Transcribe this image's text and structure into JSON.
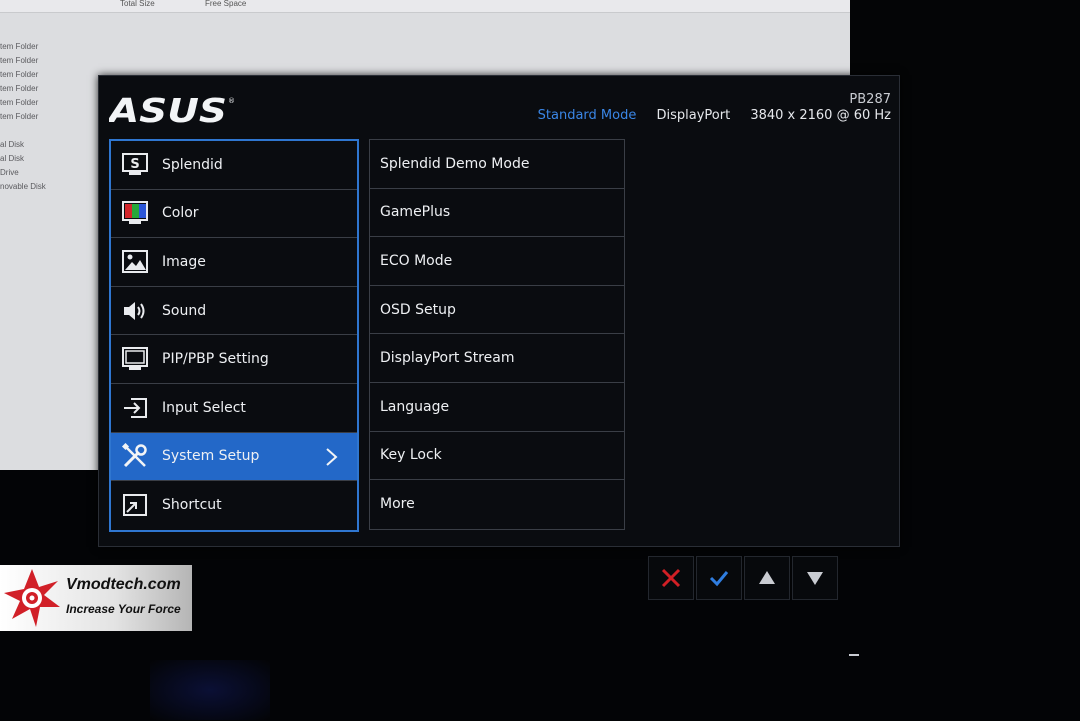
{
  "background": {
    "columns": [
      "Total Size",
      "Free Space"
    ],
    "items": [
      "tem Folder",
      "tem Folder",
      "tem Folder",
      "tem Folder",
      "tem Folder",
      "tem Folder",
      "",
      "al Disk",
      "al Disk",
      "Drive",
      "novable Disk"
    ]
  },
  "osd": {
    "brand": "ASUS",
    "header": {
      "model": "PB287",
      "mode": "Standard Mode",
      "input": "DisplayPort",
      "resolution": "3840 x 2160 @ 60 Hz"
    },
    "menu": [
      {
        "label": "Splendid",
        "icon": "splendid-icon"
      },
      {
        "label": "Color",
        "icon": "color-icon"
      },
      {
        "label": "Image",
        "icon": "image-icon"
      },
      {
        "label": "Sound",
        "icon": "speaker-icon"
      },
      {
        "label": "PIP/PBP Setting",
        "icon": "pip-icon"
      },
      {
        "label": "Input Select",
        "icon": "input-icon"
      },
      {
        "label": "System Setup",
        "icon": "tools-icon",
        "active": true
      },
      {
        "label": "Shortcut",
        "icon": "shortcut-icon"
      }
    ],
    "submenu": [
      "Splendid Demo Mode",
      "GamePlus",
      "ECO Mode",
      "OSD Setup",
      "DisplayPort Stream",
      "Language",
      "Key Lock",
      "More"
    ]
  },
  "keys": [
    "close-icon",
    "check-icon",
    "up-arrow-icon",
    "down-arrow-icon"
  ],
  "colors": {
    "accent": "#2368c8",
    "mode_text": "#3a86e6",
    "close_key": "#d11f25",
    "check_key": "#2f7de0"
  },
  "watermark": {
    "name": "Vmodtech.com",
    "tagline": "Increase Your Force"
  }
}
